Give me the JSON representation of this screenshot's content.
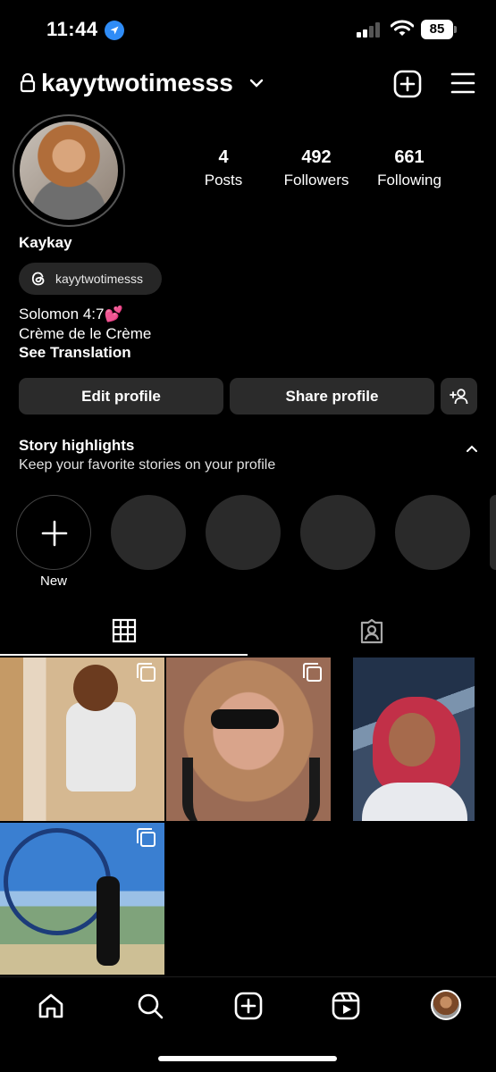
{
  "status_bar": {
    "time": "11:44",
    "battery": "85",
    "icons": [
      "location-arrow-icon",
      "cellular-signal-icon",
      "wifi-icon",
      "battery-icon"
    ]
  },
  "header": {
    "username": "kayytwotimesss",
    "icons": [
      "lock-icon",
      "chevron-down-icon",
      "add-post-icon",
      "menu-icon"
    ]
  },
  "profile": {
    "stats": [
      {
        "count": "4",
        "label": "Posts"
      },
      {
        "count": "492",
        "label": "Followers"
      },
      {
        "count": "661",
        "label": "Following"
      }
    ],
    "display_name": "Kaykay",
    "threads_handle": "kayytwotimesss",
    "bio_line1": "Solomon 4:7💕",
    "bio_line2": "Crème de le Crème",
    "see_translation": "See Translation"
  },
  "actions": {
    "edit_profile": "Edit profile",
    "share_profile": "Share profile"
  },
  "highlights": {
    "title": "Story highlights",
    "subtitle": "Keep your favorite stories on your profile",
    "new_label": "New"
  },
  "tabs": [
    "grid-icon",
    "tagged-icon"
  ],
  "bottom_nav": [
    "home-icon",
    "search-icon",
    "create-icon",
    "reels-icon",
    "profile-avatar"
  ],
  "colors": {
    "background": "#000000",
    "button": "#2b2b2b",
    "chip": "#262626",
    "accent_blue": "#2f8cf6"
  }
}
